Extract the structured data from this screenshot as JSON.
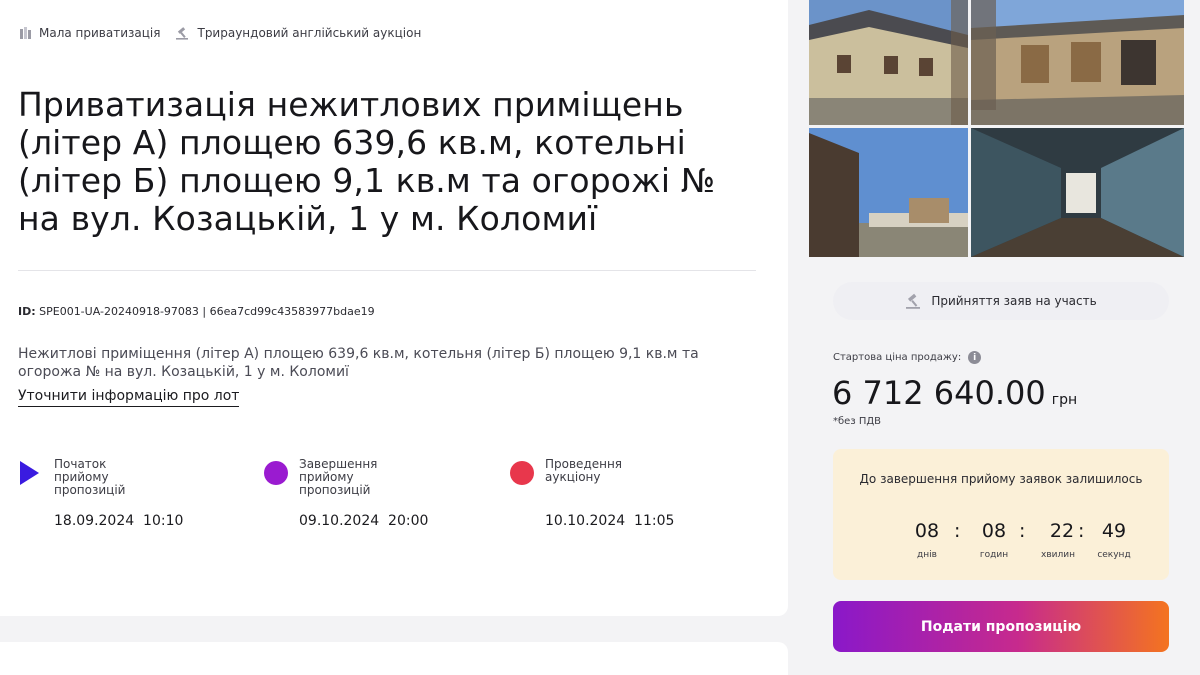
{
  "tags": [
    {
      "label": "Мала приватизація",
      "icon": "building-icon"
    },
    {
      "label": "Трираундовий англійський аукціон",
      "icon": "gavel-icon"
    }
  ],
  "lot": {
    "title": "Приватизація нежитлових приміщень (літер А) площею 639,6 кв.м, котельні (літер Б) площею 9,1 кв.м та огорожі № на вул. Козацькій, 1 у м. Коломиї",
    "id_label": "ID:",
    "id_value": "SPE001-UA-20240918-97083 | 66ea7cd99c43583977bdae19",
    "description": "Нежитлові приміщення (літер А) площею 639,6 кв.м, котельня (літер Б) площею 9,1 кв.м та огорожа № на вул. Козацькій, 1 у м. Коломиї",
    "more_link": "Уточнити інформацію про лот"
  },
  "timeline": [
    {
      "label": "Початок\nприйому\nпропозицій",
      "date": "18.09.2024  10:10",
      "color": "#3a1be0",
      "icon": "play-icon"
    },
    {
      "label": "Завершення\nприйому\nпропозицій",
      "date": "09.10.2024  20:00",
      "color": "#9a1bd0",
      "icon": "circle-icon"
    },
    {
      "label": "Проведення\nаукціону",
      "date": "10.10.2024  11:05",
      "color": "#e8374c",
      "icon": "circle-icon"
    }
  ],
  "status": {
    "label": "Прийняття заяв на участь",
    "icon": "gavel-icon"
  },
  "price": {
    "label": "Стартова ціна продажу:",
    "value": "6 712 640.00",
    "currency": "грн",
    "vat_note": "*без ПДВ"
  },
  "countdown": {
    "title": "До завершення прийому заявок залишилось",
    "days": "08",
    "hours": "08",
    "minutes": "22",
    "seconds": "49",
    "days_label": "днів",
    "hours_label": "годин",
    "minutes_label": "хвилин",
    "seconds_label": "секунд",
    "separator": ":"
  },
  "submit_button": "Подати пропозицію",
  "colors": {
    "accent_start": "#8a18c9",
    "accent_end": "#f4741f",
    "countdown_bg": "#fbf0d8"
  }
}
